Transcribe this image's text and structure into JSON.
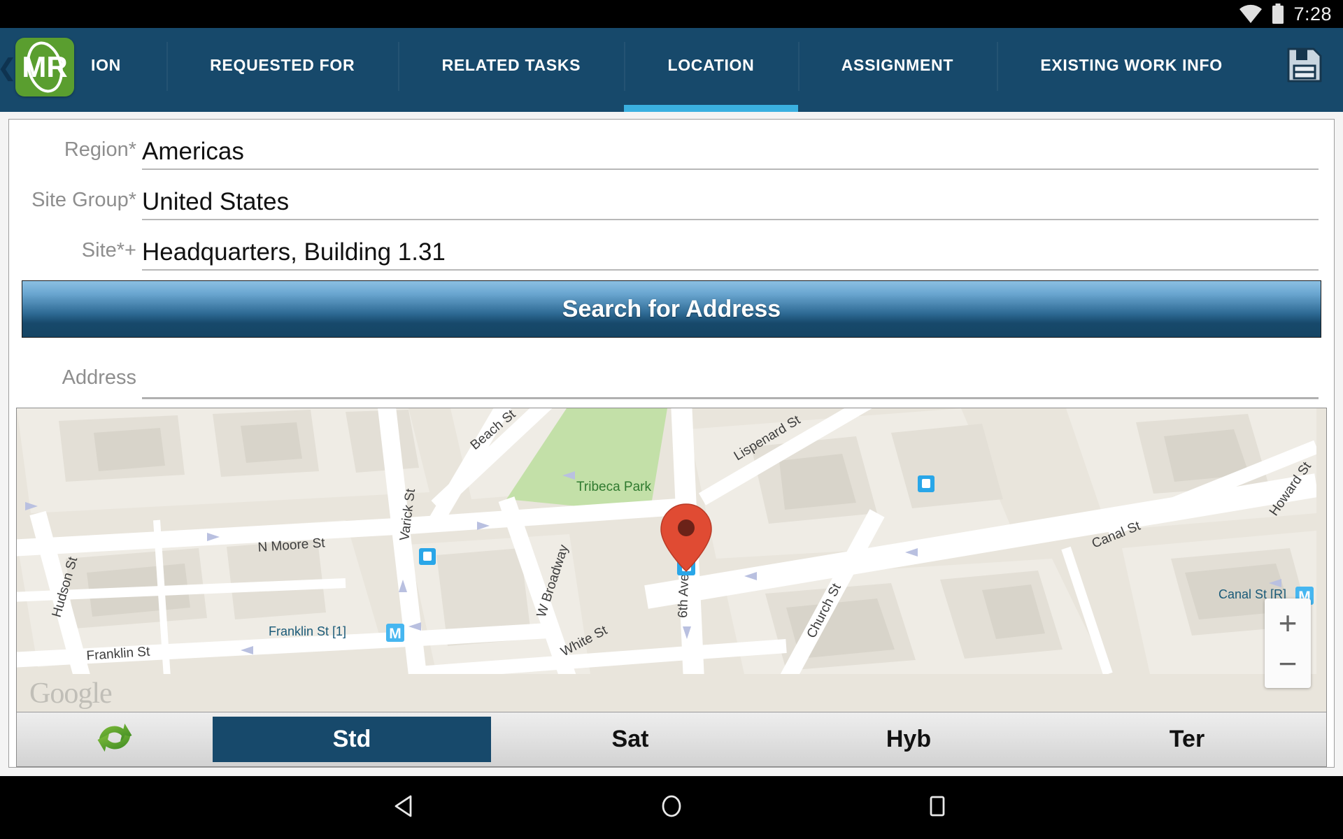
{
  "status_bar": {
    "wifi_icon": "wifi-icon",
    "battery_icon": "battery-icon",
    "time": "7:28"
  },
  "header": {
    "back_icon": "back-chevron-icon",
    "logo": {
      "name": "mr-app-logo",
      "text": "MR"
    },
    "save_icon": "save-floppy-icon",
    "tabs": [
      {
        "label": "ION",
        "active": false
      },
      {
        "label": "REQUESTED FOR",
        "active": false
      },
      {
        "label": "RELATED TASKS",
        "active": false
      },
      {
        "label": "LOCATION",
        "active": true
      },
      {
        "label": "ASSIGNMENT",
        "active": false
      },
      {
        "label": "EXISTING WORK INFO",
        "active": false
      }
    ],
    "active_tab_color": "#3ab0e0",
    "background_color": "#17496b"
  },
  "form": {
    "fields": [
      {
        "label": "Region*",
        "value": "Americas",
        "placeholder": ""
      },
      {
        "label": "Site Group*",
        "value": "United States",
        "placeholder": ""
      },
      {
        "label": "Site*+",
        "value": "Headquarters, Building 1.31",
        "placeholder": ""
      }
    ],
    "search_button": "Search for Address",
    "address": {
      "label": "Address",
      "value": "",
      "placeholder": ""
    }
  },
  "map": {
    "watermark": "Google",
    "marker": "location-pin-marker",
    "zoom_in": "+",
    "zoom_out": "−",
    "park_label": "Tribeca Park",
    "streets": [
      "Beach St",
      "Lispenard St",
      "Howard St",
      "Canal St",
      "Varick St",
      "N Moore St",
      "Hudson St",
      "Franklin St",
      "W Broadway",
      "White St",
      "6th Ave",
      "Church St"
    ],
    "transit_labels": [
      {
        "text": "Franklin St [1]",
        "badge": "M"
      },
      {
        "text": "Canal St [R]",
        "badge": "M"
      }
    ],
    "map_types": [
      {
        "label": "Std",
        "selected": true
      },
      {
        "label": "Sat",
        "selected": false
      },
      {
        "label": "Hyb",
        "selected": false
      },
      {
        "label": "Ter",
        "selected": false
      }
    ],
    "refresh_icon": "refresh-sync-icon"
  },
  "nav_bar": {
    "back": "back-triangle-icon",
    "home": "home-circle-icon",
    "recents": "recents-square-icon"
  }
}
